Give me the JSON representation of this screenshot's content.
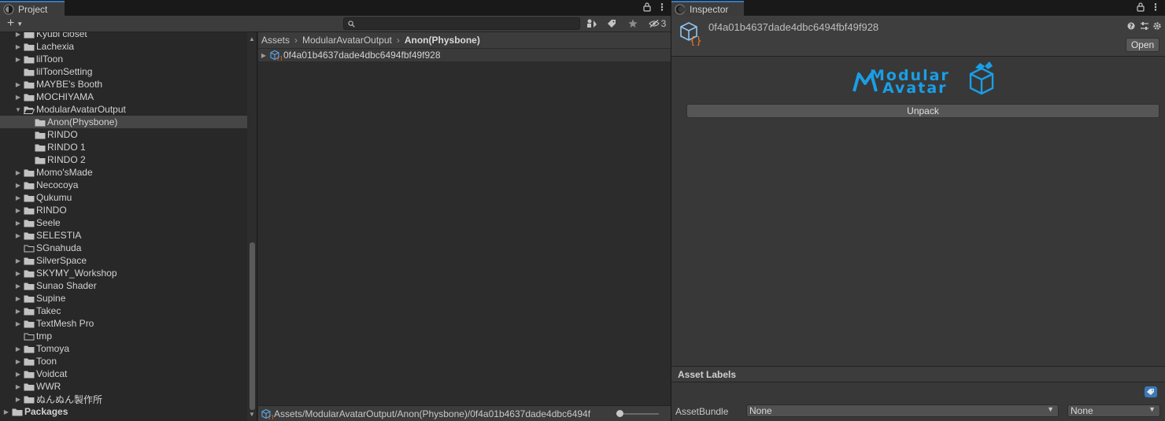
{
  "project": {
    "tab_title": "Project",
    "add_label": "+",
    "hidden_count": "3",
    "tree_items": [
      {
        "label": "Kyubi closet",
        "arrow": "▶",
        "icon": "folder",
        "indent": 0
      },
      {
        "label": "Lachexia",
        "arrow": "▶",
        "icon": "folder",
        "indent": 0
      },
      {
        "label": "lilToon",
        "arrow": "▶",
        "icon": "folder",
        "indent": 0
      },
      {
        "label": "lilToonSetting",
        "arrow": "",
        "icon": "folder",
        "indent": 0
      },
      {
        "label": "MAYBE's Booth",
        "arrow": "▶",
        "icon": "folder",
        "indent": 0
      },
      {
        "label": "MOCHIYAMA",
        "arrow": "▶",
        "icon": "folder",
        "indent": 0
      },
      {
        "label": "ModularAvatarOutput",
        "arrow": "▼",
        "icon": "folder-open",
        "indent": 0
      },
      {
        "label": "Anon(Physbone)",
        "arrow": "",
        "icon": "folder",
        "indent": 1,
        "selected": true
      },
      {
        "label": "RINDO",
        "arrow": "",
        "icon": "folder",
        "indent": 1
      },
      {
        "label": "RINDO 1",
        "arrow": "",
        "icon": "folder",
        "indent": 1
      },
      {
        "label": "RINDO 2",
        "arrow": "",
        "icon": "folder",
        "indent": 1
      },
      {
        "label": "Momo'sMade",
        "arrow": "▶",
        "icon": "folder",
        "indent": 0
      },
      {
        "label": "Necocoya",
        "arrow": "▶",
        "icon": "folder",
        "indent": 0
      },
      {
        "label": "Qukumu",
        "arrow": "▶",
        "icon": "folder",
        "indent": 0
      },
      {
        "label": "RINDO",
        "arrow": "▶",
        "icon": "folder",
        "indent": 0
      },
      {
        "label": "Seele",
        "arrow": "▶",
        "icon": "folder",
        "indent": 0
      },
      {
        "label": "SELESTIA",
        "arrow": "▶",
        "icon": "folder",
        "indent": 0
      },
      {
        "label": "SGnahuda",
        "arrow": "",
        "icon": "folder-empty",
        "indent": 0
      },
      {
        "label": "SilverSpace",
        "arrow": "▶",
        "icon": "folder",
        "indent": 0
      },
      {
        "label": "SKYMY_Workshop",
        "arrow": "▶",
        "icon": "folder",
        "indent": 0
      },
      {
        "label": "Sunao Shader",
        "arrow": "▶",
        "icon": "folder",
        "indent": 0
      },
      {
        "label": "Supine",
        "arrow": "▶",
        "icon": "folder",
        "indent": 0
      },
      {
        "label": "Takec",
        "arrow": "▶",
        "icon": "folder",
        "indent": 0
      },
      {
        "label": "TextMesh Pro",
        "arrow": "▶",
        "icon": "folder",
        "indent": 0
      },
      {
        "label": "tmp",
        "arrow": "",
        "icon": "folder-empty",
        "indent": 0
      },
      {
        "label": "Tomoya",
        "arrow": "▶",
        "icon": "folder",
        "indent": 0
      },
      {
        "label": "Toon",
        "arrow": "▶",
        "icon": "folder",
        "indent": 0
      },
      {
        "label": "Voidcat",
        "arrow": "▶",
        "icon": "folder",
        "indent": 0
      },
      {
        "label": "WWR",
        "arrow": "▶",
        "icon": "folder",
        "indent": 0
      },
      {
        "label": "ぬんぬん製作所",
        "arrow": "▶",
        "icon": "folder",
        "indent": 0
      },
      {
        "label": "Packages",
        "arrow": "▶",
        "icon": "folder",
        "indent": -1,
        "bold": true
      }
    ],
    "breadcrumb": [
      "Assets",
      "ModularAvatarOutput",
      "Anon(Physbone)"
    ],
    "asset_name": "0f4a01b4637dade4dbc6494fbf49f928",
    "status_path": "Assets/ModularAvatarOutput/Anon(Physbone)/0f4a01b4637dade4dbc6494f"
  },
  "inspector": {
    "tab_title": "Inspector",
    "asset_name": "0f4a01b4637dade4dbc6494fbf49f928",
    "open_label": "Open",
    "logo_line1": "Modular",
    "logo_line2": "Avatar",
    "unpack_label": "Unpack",
    "asset_labels_title": "Asset Labels",
    "assetbundle_label": "AssetBundle",
    "assetbundle_value": "None",
    "variant_value": "None"
  },
  "colors": {
    "accent_tab": "#3a79bb",
    "logo_blue": "#1a9ee6",
    "asset_icon_orange": "#f0782a"
  }
}
